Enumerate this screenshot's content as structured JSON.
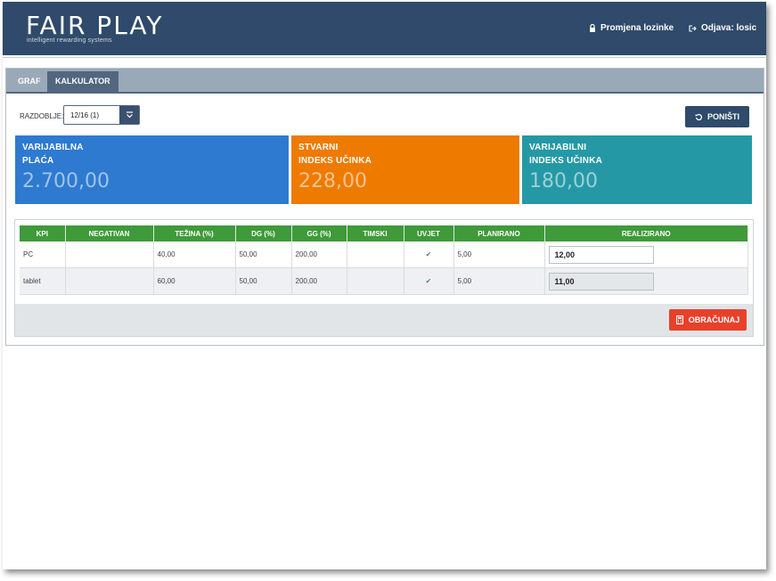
{
  "header": {
    "logo": "FAIR PLAY",
    "tagline": "intelligent rewarding systems",
    "change_password": "Promjena lozinke",
    "logout": "Odjava: losic"
  },
  "tabs": [
    {
      "label": "GRAF"
    },
    {
      "label": "KALKULATOR"
    }
  ],
  "period": {
    "label": "RAZDOBLJE:",
    "value": "12/16 (1)"
  },
  "reset_label": "PONIŠTI",
  "cards": [
    {
      "line1": "VARIJABILNA",
      "line2": "PLAĆA",
      "value": "2.700,00",
      "color": "#2d7ad0"
    },
    {
      "line1": "STVARNI",
      "line2": "INDEKS UČINKA",
      "value": "228,00",
      "color": "#ee7a00"
    },
    {
      "line1": "VARIJABILNI",
      "line2": "INDEKS UČINKA",
      "value": "180,00",
      "color": "#2598a6"
    }
  ],
  "table": {
    "headers": [
      "KPI",
      "NEGATIVAN",
      "TEŽINA (%)",
      "DG (%)",
      "GG (%)",
      "TIMSKI",
      "UVJET",
      "PLANIRANO",
      "REALIZIRANO"
    ],
    "rows": [
      {
        "kpi": "PC",
        "negativan": "",
        "tezina": "40,00",
        "dg": "50,00",
        "gg": "200,00",
        "timski": "",
        "uvjet": "✔",
        "planirano": "5,00",
        "realizirano": "12,00"
      },
      {
        "kpi": "tablet",
        "negativan": "",
        "tezina": "60,00",
        "dg": "50,00",
        "gg": "200,00",
        "timski": "",
        "uvjet": "✔",
        "planirano": "5,00",
        "realizirano": "11,00"
      }
    ]
  },
  "calculate_label": "OBRAČUNAJ",
  "colors": {
    "topbar": "#2f4a6a",
    "table_header": "#3f9a3a",
    "calculate": "#e8412a"
  }
}
